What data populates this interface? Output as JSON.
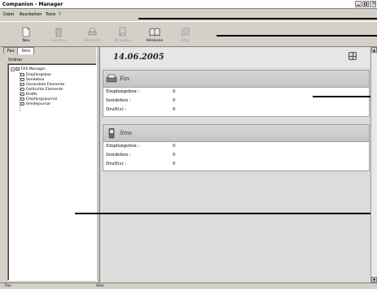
{
  "window": {
    "title": "Companion - Manager"
  },
  "menu": [
    "Datei",
    "Bearbeiten",
    "Tools",
    "?"
  ],
  "toolbar": [
    {
      "label": "Neu",
      "icon": "new-document-icon",
      "enabled": true
    },
    {
      "label": "Löschen",
      "icon": "trash-icon",
      "enabled": false
    },
    {
      "label": "Drucken",
      "icon": "printer-icon",
      "enabled": false
    },
    {
      "label": "Vorschau",
      "icon": "preview-icon",
      "enabled": false
    },
    {
      "label": "Adressen",
      "icon": "address-book-icon",
      "enabled": true
    },
    {
      "label": "Stop",
      "icon": "stop-icon",
      "enabled": false
    }
  ],
  "left_panel": {
    "tabs": [
      "Fax",
      "Sms"
    ],
    "active_tab": "Sms",
    "folder_label": "Ordner",
    "tree_root": "FAX Manager",
    "tree_children": [
      "Empfangsbox",
      "Sendebox",
      "Gesendete Elemente",
      "Gelöschte Elemente",
      "Drafts",
      "Empfangsjournal",
      "Sendejournal"
    ]
  },
  "content": {
    "date": "14.06.2005",
    "panels": [
      {
        "title": "Fax",
        "icon": "fax-icon",
        "rows": [
          {
            "label": "Empfangsbox :",
            "value": "0"
          },
          {
            "label": "Sendebox :",
            "value": "0"
          },
          {
            "label": "Draft(s) :",
            "value": "0"
          }
        ]
      },
      {
        "title": "Sms",
        "icon": "mobile-phone-icon",
        "rows": [
          {
            "label": "Empfangsbox :",
            "value": "0"
          },
          {
            "label": "Sendebox :",
            "value": "0"
          },
          {
            "label": "Draft(s) :",
            "value": "0"
          }
        ]
      }
    ]
  },
  "statusbar": [
    "Fax",
    "Sms"
  ]
}
